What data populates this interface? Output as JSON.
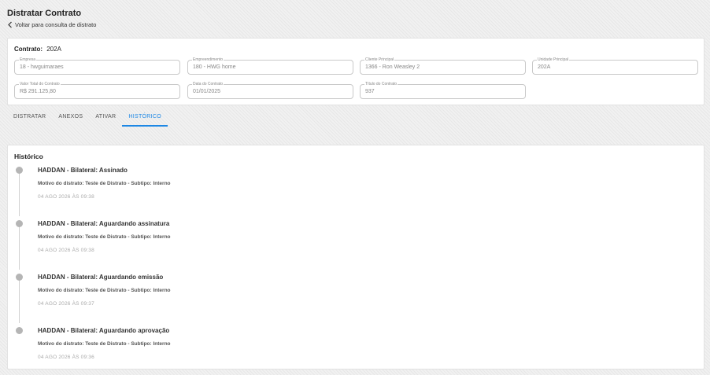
{
  "page": {
    "title": "Distratar Contrato",
    "back_label": "Voltar para consulta de distrato"
  },
  "contract": {
    "label": "Contrato:",
    "number": "202A",
    "fields": [
      {
        "label": "Empresa",
        "value": "18 - hwguimaraes"
      },
      {
        "label": "Empreendimento",
        "value": "180 - HWG home"
      },
      {
        "label": "Cliente Principal",
        "value": "1366 - Ron Weasley 2"
      },
      {
        "label": "Unidade Principal",
        "value": "202A"
      },
      {
        "label": "Valor Total do Contrato",
        "value": "R$ 291.125,80"
      },
      {
        "label": "Data do Contrato",
        "value": "01/01/2025"
      },
      {
        "label": "Título do Contrato",
        "value": "937"
      }
    ]
  },
  "tabs": [
    {
      "label": "DISTRATAR"
    },
    {
      "label": "ANEXOS"
    },
    {
      "label": "ATIVAR"
    },
    {
      "label": "HISTÓRICO",
      "active": true
    }
  ],
  "history": {
    "title": "Histórico",
    "entries": [
      {
        "title": "HADDAN - Bilateral: Assinado",
        "desc": "Motivo do distrato: Teste de Distrato - Subtipo: Interno",
        "time": "04 AGO 2026 ÀS 09:38"
      },
      {
        "title": "HADDAN - Bilateral: Aguardando assinatura",
        "desc": "Motivo do distrato: Teste de Distrato - Subtipo: Interno",
        "time": "04 AGO 2026 ÀS 09:38"
      },
      {
        "title": "HADDAN - Bilateral: Aguardando emissão",
        "desc": "Motivo do distrato: Teste de Distrato - Subtipo: Interno",
        "time": "04 AGO 2026 ÀS 09:37"
      },
      {
        "title": "HADDAN - Bilateral: Aguardando aprovação",
        "desc": "Motivo do distrato: Teste de Distrato - Subtipo: Interno",
        "time": "04 AGO 2026 ÀS 09:36"
      }
    ]
  },
  "colors": {
    "accent": "#1e88e5",
    "timeline_dot": "#b5b5b5"
  }
}
